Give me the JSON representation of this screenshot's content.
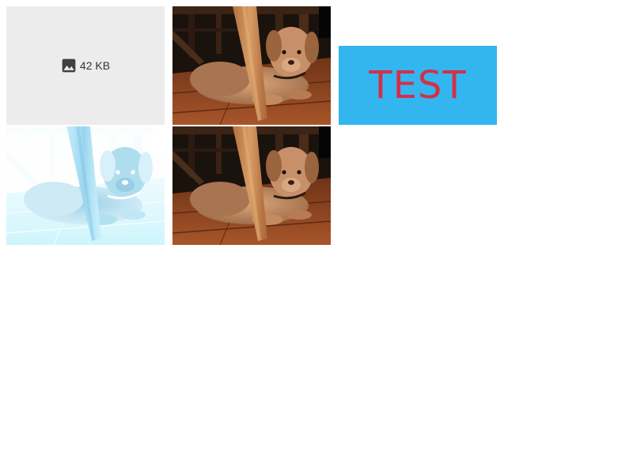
{
  "placeholder": {
    "icon": "image-icon",
    "size_label": "42 KB",
    "background": "#ececec"
  },
  "photos": [
    {
      "name": "puppy-photo",
      "filter": "normal"
    },
    {
      "name": "puppy-photo-inverted",
      "filter": "color-inverted"
    },
    {
      "name": "puppy-photo-copy",
      "filter": "normal"
    }
  ],
  "test_banner": {
    "label": "TEST",
    "background": "#33b5f0",
    "text_color": "#d62f45"
  }
}
